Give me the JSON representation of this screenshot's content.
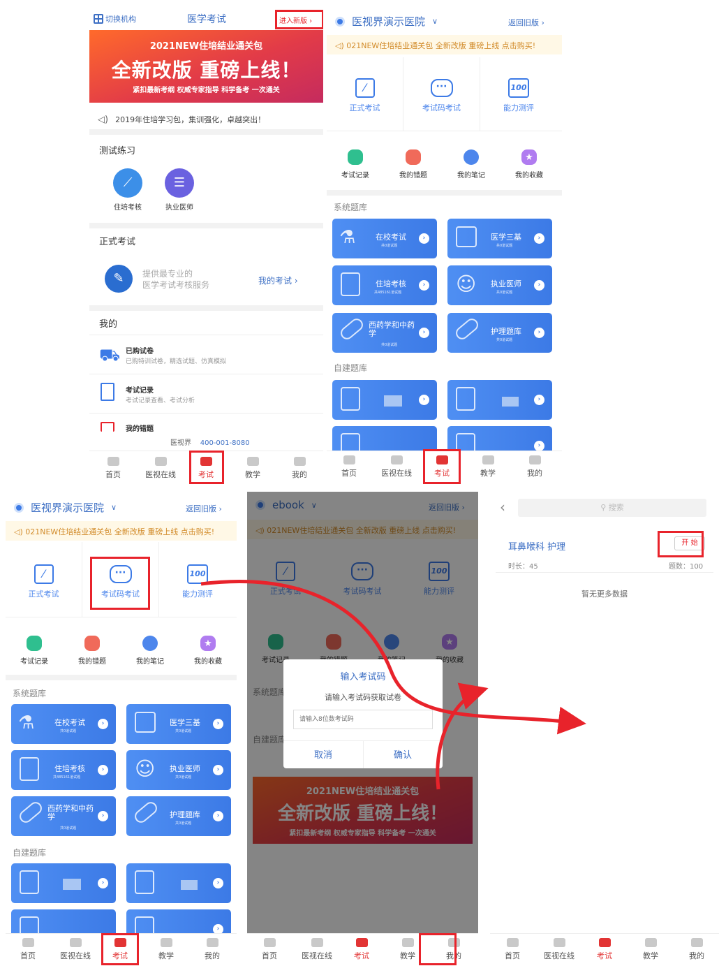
{
  "panel1": {
    "switch_org": "切换机构",
    "title": "医学考试",
    "enter_new": "进入新版",
    "banner": {
      "top": "2021NEW住培结业通关包",
      "main": "全新改版 重磅上线！",
      "sub": "紧扣最新考纲  权威专家指导  科学备考  一次通关"
    },
    "notice": "2019年住培学习包，集训强化，卓越突出！",
    "practice_title": "测试练习",
    "practice": [
      {
        "label": "住培考核",
        "icon": "chart-icon"
      },
      {
        "label": "执业医师",
        "icon": "doctor-icon"
      }
    ],
    "formal_title": "正式考试",
    "formal_desc1": "提供最专业的",
    "formal_desc2": "医学考试考核服务",
    "my_exam": "我的考试",
    "mine_title": "我的",
    "mine_items": [
      {
        "title": "已购试卷",
        "desc": "已购特训试卷，精选试题、仿真模拟"
      },
      {
        "title": "考试记录",
        "desc": "考试记录查看、考试分析"
      },
      {
        "title": "我的错题",
        "desc": ""
      }
    ],
    "footer_brand": "医视界",
    "footer_phone": "400-001-8080"
  },
  "hospital": {
    "name": "医视界演示医院",
    "back": "返回旧版",
    "notice": "021NEW住培结业通关包 全新改版 重磅上线 点击购买!",
    "main_btns": [
      "正式考试",
      "考试码考试",
      "能力测评"
    ],
    "small_btns": [
      {
        "label": "考试记录",
        "color": "#2fbf8f"
      },
      {
        "label": "我的错题",
        "color": "#f06a5a"
      },
      {
        "label": "我的笔记",
        "color": "#4d86ec"
      },
      {
        "label": "我的收藏",
        "color": "#b07cf0"
      }
    ],
    "sys_title": "系统题库",
    "sys_cards": [
      {
        "title": "在校考试",
        "sub": "共0道试题"
      },
      {
        "title": "医学三基",
        "sub": "共0道试题"
      },
      {
        "title": "住培考核",
        "sub": "共485161道试题"
      },
      {
        "title": "执业医师",
        "sub": "共0道试题"
      },
      {
        "title": "西药学和中药学",
        "sub": "共0道试题"
      },
      {
        "title": "护理题库",
        "sub": "共0道试题"
      }
    ],
    "self_title": "自建题库"
  },
  "panel4": {
    "org": "ebook",
    "back": "返回旧版",
    "dialog_title": "输入考试码",
    "dialog_desc": "请输入考试码获取试卷",
    "dialog_placeholder": "请输入8位数考试码",
    "cancel": "取消",
    "confirm": "确认"
  },
  "panel5": {
    "search": "搜索",
    "exam_name": "耳鼻喉科 护理",
    "start": "开 始",
    "duration": "时长：45",
    "count": "题数：100",
    "no_more": "暂无更多数据"
  },
  "tabs": [
    "首页",
    "医视在线",
    "考试",
    "教学",
    "我的"
  ],
  "colors": {
    "accent": "#3c7ae6",
    "highlight": "#e8232b",
    "active_tab": "#e23434"
  }
}
